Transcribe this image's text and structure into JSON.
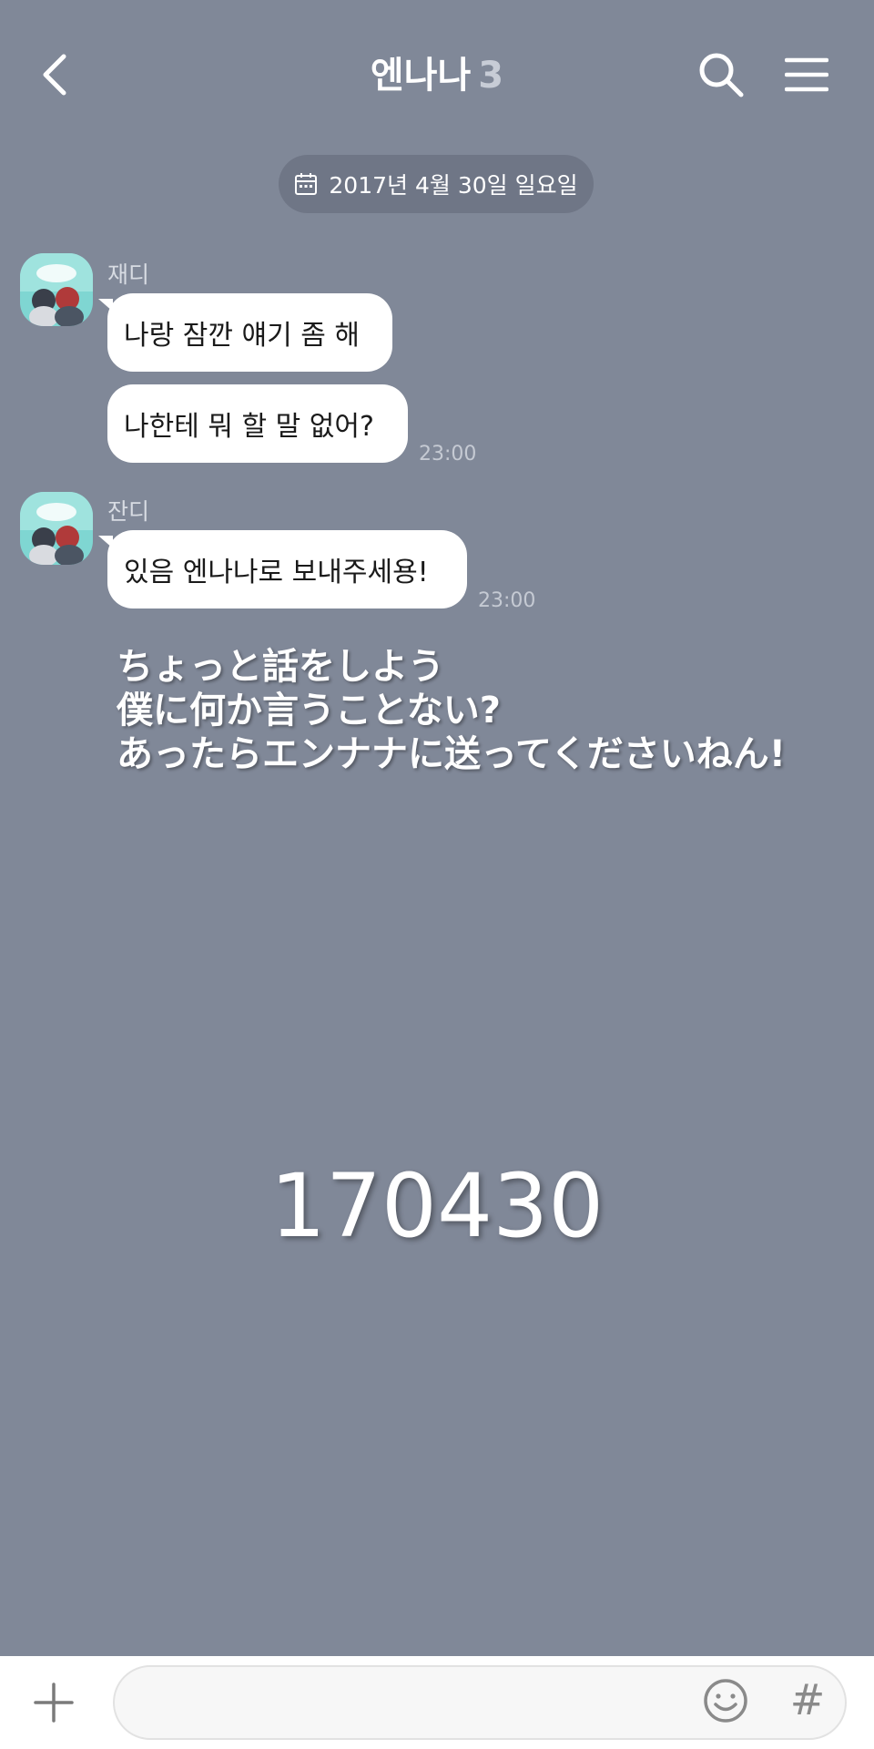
{
  "header": {
    "title": "엔나나",
    "member_count": "3",
    "icons": {
      "back": "chevron-left-icon",
      "search": "search-icon",
      "menu": "hamburger-menu-icon"
    }
  },
  "date_divider": {
    "label": "2017년 4월 30일 일요일",
    "icon": "calendar-icon"
  },
  "messages": [
    {
      "sender": "재디",
      "texts": [
        "나랑 잠깐 얘기 좀 해",
        "나한테 뭐 할 말 없어?"
      ],
      "time": "23:00"
    },
    {
      "sender": "잔디",
      "texts": [
        "있음 엔나나로 보내주세용!"
      ],
      "time": "23:00"
    }
  ],
  "overlay": {
    "japanese_lines": [
      "ちょっと話をしよう",
      "僕に何か言うことない?",
      "あったらエンナナに送ってくださいねん!"
    ],
    "number": "170430"
  },
  "input_bar": {
    "placeholder": "",
    "icons": {
      "add": "plus-icon",
      "emoji": "emoji-icon",
      "hashtag": "hashtag-icon"
    },
    "hashtag_label": "#"
  },
  "colors": {
    "background": "#808898",
    "bubble": "#ffffff",
    "date_pill": "#6f7686"
  }
}
